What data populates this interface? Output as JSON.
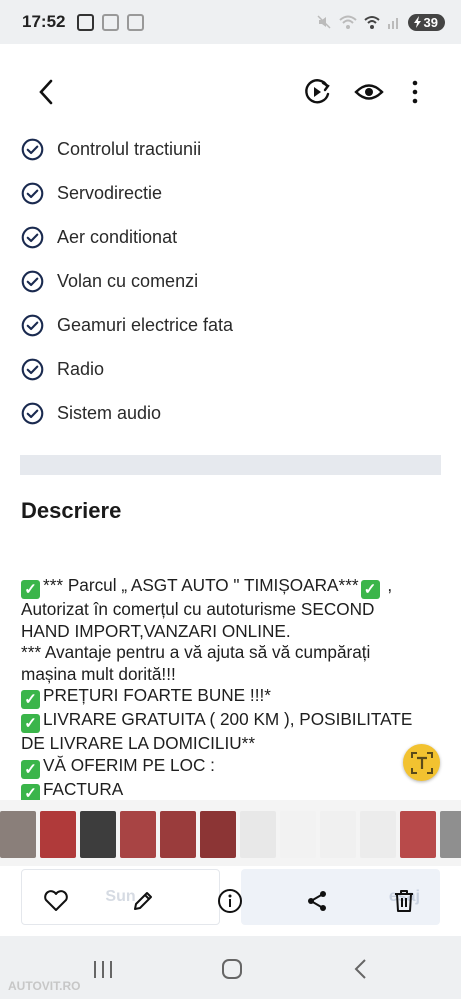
{
  "status_bar": {
    "time": "17:52",
    "battery": "39"
  },
  "header": {
    "back_icon": "chevron-left-icon",
    "actions": [
      "play-rotate-icon",
      "eye-icon",
      "more-vertical-icon"
    ]
  },
  "features": [
    "Controlul tractiunii",
    "Servodirectie",
    "Aer conditionat",
    "Volan cu comenzi",
    "Geamuri electrice fata",
    "Radio",
    "Sistem audio"
  ],
  "description": {
    "title": "Descriere",
    "lines": [
      {
        "check": true,
        "text": "*** Parcul „ ASGT AUTO \" TIMIȘOARA***",
        "check_after": true,
        "tail": " ,"
      },
      {
        "check": false,
        "text": "Autorizat în comerțul cu autoturisme SECOND"
      },
      {
        "check": false,
        "text": "HAND IMPORT,VANZARI ONLINE."
      },
      {
        "check": false,
        "text": "*** Avantaje pentru a vă ajuta să vă cumpărați"
      },
      {
        "check": false,
        "text": "mașina mult dorită!!!"
      },
      {
        "check": true,
        "text": "PREȚURI FOARTE BUNE !!!*"
      },
      {
        "check": true,
        "text": "LIVRARE GRATUITA ( 200 KM ), POSIBILITATE"
      },
      {
        "check": false,
        "text": "DE LIVRARE LA DOMICILIU**"
      },
      {
        "check": true,
        "text": "VĂ OFERIM PE LOC :"
      },
      {
        "check": true,
        "text": "FACTURA"
      }
    ]
  },
  "thumbnails": [
    {
      "color": "#8a7f7a"
    },
    {
      "color": "#b03a3a"
    },
    {
      "color": "#3d3d3d"
    },
    {
      "color": "#a84444"
    },
    {
      "color": "#9a3c3c"
    },
    {
      "color": "#8c3535"
    },
    {
      "color": "#e8e8e8"
    },
    {
      "color": "#f2f2f2"
    },
    {
      "color": "#f0f0f0"
    },
    {
      "color": "#ececec"
    },
    {
      "color": "#b84a4a"
    },
    {
      "color": "#8f8f8f"
    }
  ],
  "bottom_bar": {
    "left_button": "Sun",
    "right_button": "esaj",
    "icons": [
      "heart-icon",
      "pencil-icon",
      "info-icon",
      "share-icon",
      "trash-icon"
    ]
  },
  "watermark": "AUTOVIT.RO",
  "colors": {
    "accent": "#1a2a4f",
    "check_green": "#3bb54a",
    "fab": "#f2c230"
  }
}
